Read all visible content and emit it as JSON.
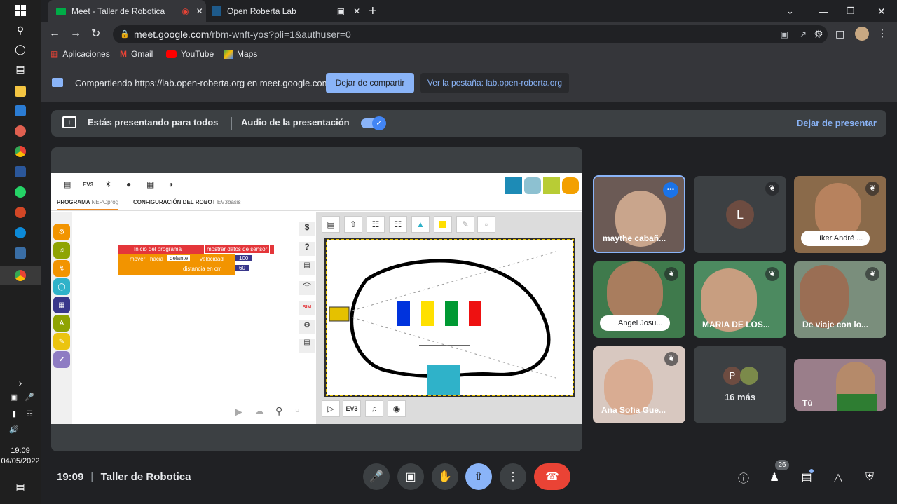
{
  "browser": {
    "tab1_title": "Meet - Taller de Robotica",
    "tab2_title": "Open Roberta Lab",
    "url_host": "meet.google.com",
    "url_path": "/rbm-wnft-yos?pli=1&authuser=0"
  },
  "bookmarks": [
    {
      "label": "Aplicaciones"
    },
    {
      "label": "Gmail"
    },
    {
      "label": "YouTube"
    },
    {
      "label": "Maps"
    }
  ],
  "share_bar": {
    "text": "Compartiendo https://lab.open-roberta.org en meet.google.com",
    "stop_label": "Dejar de compartir",
    "view_label": "Ver la pestaña: lab.open-roberta.org"
  },
  "presenting": {
    "text": "Estás presentando para todos",
    "audio_label": "Audio de la presentación",
    "stop_label": "Dejar de presentar"
  },
  "lab": {
    "header_ev3": "EV3",
    "tab_program": "PROGRAMA",
    "tab_program_sub": "NEPOprog",
    "tab_config": "CONFIGURACIÓN DEL ROBOT",
    "tab_config_sub": "EV3basis",
    "block_start": "Inicio del programa",
    "block_sensor": "mostrar datos de sensor",
    "block_move": "mover",
    "block_hacia": "hacia",
    "block_dir": "delante",
    "block_vel": "velocidad",
    "block_vel_val": "100",
    "block_dist": "distancia en cm",
    "block_dist_val": "60",
    "sim_label": "SIM",
    "ev3_btn": "EV3"
  },
  "participants": [
    {
      "name": "maythe cabañ..."
    },
    {
      "initial": "L"
    },
    {
      "name": "Iker André ..."
    },
    {
      "name": "Angel Josu..."
    },
    {
      "name": "MARIA DE LOS..."
    },
    {
      "name": "De viaje con lo..."
    },
    {
      "name": "Ana Sofia Gue..."
    },
    {
      "initial": "P",
      "more": "16 más"
    },
    {
      "name": "Tú"
    }
  ],
  "meeting": {
    "time": "19:09",
    "title": "Taller de Robotica",
    "people_count": "26"
  },
  "taskbar": {
    "time": "19:09",
    "date": "04/05/2022"
  },
  "colors": {
    "accent": "#8ab4f8",
    "red": "#ea4335"
  }
}
